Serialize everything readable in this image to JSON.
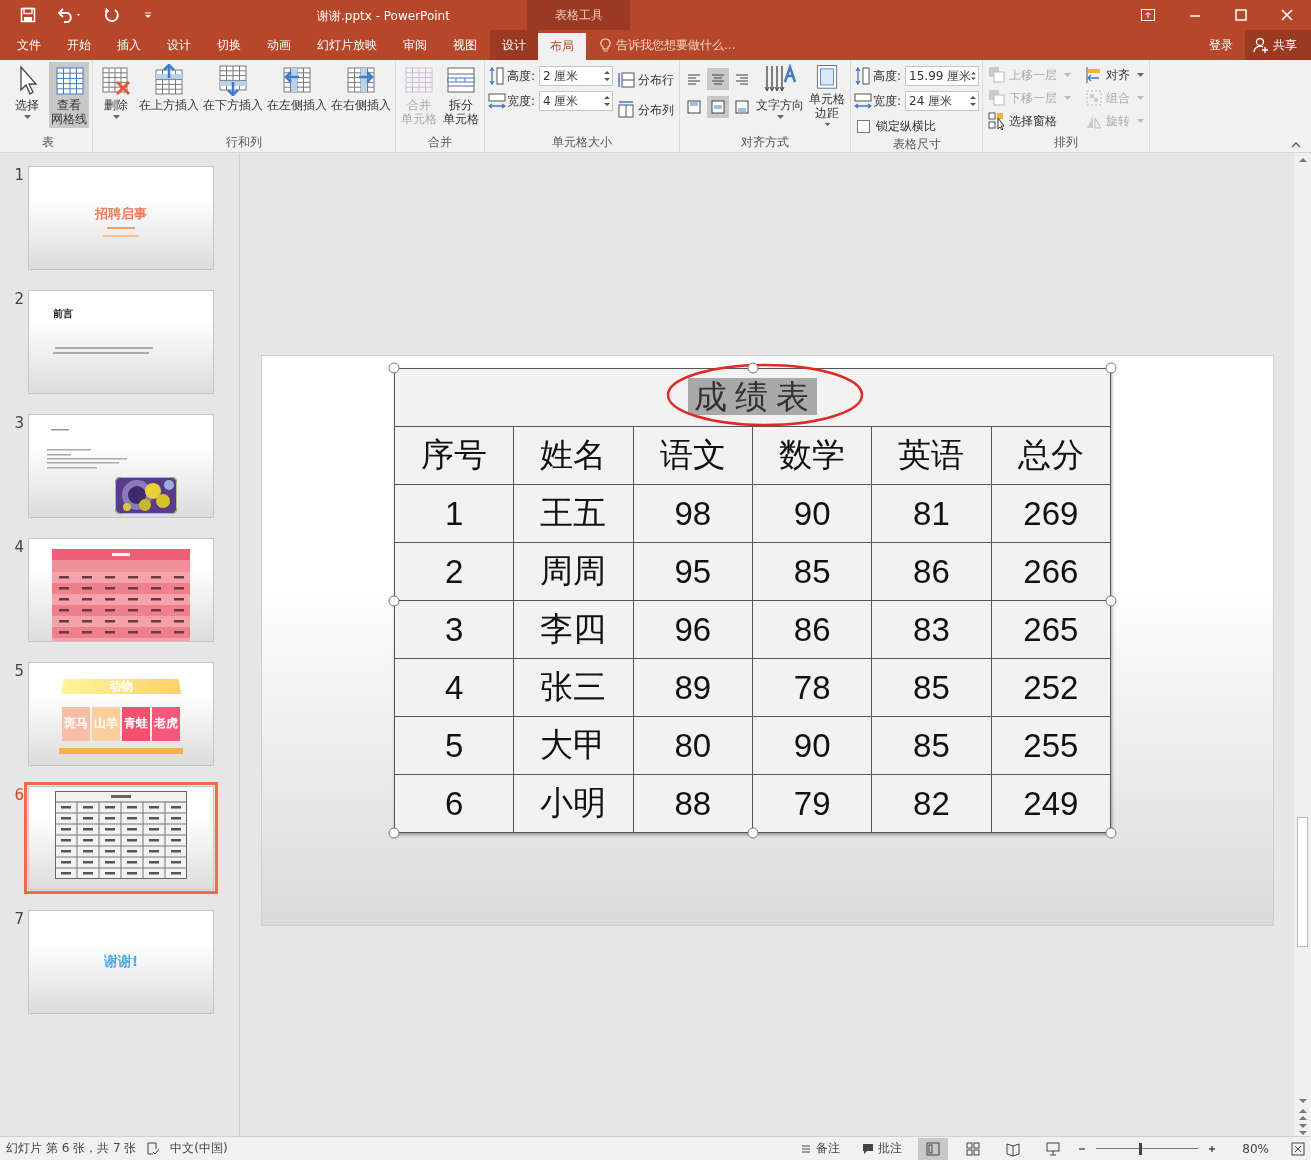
{
  "window": {
    "title": "谢谢.pptx - PowerPoint",
    "context_tab": "表格工具"
  },
  "menu_tabs": [
    {
      "label": "文件",
      "selected": false,
      "kind": "main"
    },
    {
      "label": "开始",
      "selected": false,
      "kind": "main"
    },
    {
      "label": "插入",
      "selected": false,
      "kind": "main"
    },
    {
      "label": "设计",
      "selected": false,
      "kind": "main"
    },
    {
      "label": "切换",
      "selected": false,
      "kind": "main"
    },
    {
      "label": "动画",
      "selected": false,
      "kind": "main"
    },
    {
      "label": "幻灯片放映",
      "selected": false,
      "kind": "main"
    },
    {
      "label": "审阅",
      "selected": false,
      "kind": "main"
    },
    {
      "label": "视图",
      "selected": false,
      "kind": "main"
    },
    {
      "label": "设计",
      "selected": false,
      "kind": "context"
    },
    {
      "label": "布局",
      "selected": true,
      "kind": "context"
    }
  ],
  "tell_me": {
    "placeholder": "告诉我您想要做什么..."
  },
  "account": {
    "sign_in": "登录",
    "share": "共享"
  },
  "ribbon": [
    {
      "label": "表",
      "kind": "large",
      "items": [
        {
          "lines": [
            "选择"
          ],
          "kind": "cursor",
          "dropdown": true,
          "on": false,
          "disabled": false
        },
        {
          "lines": [
            "查看",
            "网格线"
          ],
          "kind": "gridlines",
          "dropdown": false,
          "on": true,
          "disabled": false
        }
      ]
    },
    {
      "label": "行和列",
      "kind": "large",
      "items": [
        {
          "lines": [
            "删除"
          ],
          "kind": "delete",
          "dropdown": true,
          "on": false,
          "disabled": false
        },
        {
          "lines": [
            "在上方插入"
          ],
          "kind": "above",
          "dropdown": false,
          "on": false,
          "disabled": false
        },
        {
          "lines": [
            "在下方插入"
          ],
          "kind": "below",
          "dropdown": false,
          "on": false,
          "disabled": false
        },
        {
          "lines": [
            "在左侧插入"
          ],
          "kind": "left",
          "dropdown": false,
          "on": false,
          "disabled": false
        },
        {
          "lines": [
            "在右侧插入"
          ],
          "kind": "right",
          "dropdown": false,
          "on": false,
          "disabled": false
        }
      ]
    },
    {
      "label": "合并",
      "kind": "large",
      "items": [
        {
          "lines": [
            "合并",
            "单元格"
          ],
          "kind": "merge",
          "dropdown": false,
          "on": false,
          "disabled": true
        },
        {
          "lines": [
            "拆分",
            "单元格"
          ],
          "kind": "split",
          "dropdown": false,
          "on": false,
          "disabled": false
        }
      ]
    },
    {
      "label": "单元格大小",
      "kind": "cellsize",
      "fields": [
        {
          "label": "高度:",
          "value": "2 厘米",
          "kind": "height"
        },
        {
          "label": "宽度:",
          "value": "4 厘米",
          "kind": "width"
        }
      ],
      "buttons": [
        {
          "label": "分布行",
          "kind": "distrows"
        },
        {
          "label": "分布列",
          "kind": "distcols"
        }
      ]
    },
    {
      "label": "对齐方式",
      "kind": "align",
      "buttons": [
        {
          "kind": "left",
          "selected": false
        },
        {
          "kind": "center",
          "selected": true
        },
        {
          "kind": "right",
          "selected": false
        },
        {
          "kind": "top",
          "selected": false
        },
        {
          "kind": "middle",
          "selected": true
        },
        {
          "kind": "bottom",
          "selected": false
        }
      ],
      "items": [
        {
          "lines": [
            "文字方向"
          ],
          "kind": "textdir",
          "dropdown": true,
          "on": false,
          "disabled": false
        },
        {
          "lines": [
            "单元格",
            "边距"
          ],
          "kind": "margins",
          "dropdown": true,
          "on": false,
          "disabled": false
        }
      ]
    },
    {
      "label": "表格尺寸",
      "kind": "tablesize",
      "fields": [
        {
          "label": "高度:",
          "value": "15.99 厘米",
          "kind": "height"
        },
        {
          "label": "宽度:",
          "value": "24 厘米",
          "kind": "width"
        }
      ],
      "checkbox": {
        "label": "锁定纵横比",
        "checked": false
      }
    },
    {
      "label": "排列",
      "kind": "arrange",
      "items": [
        {
          "label": "上移一层",
          "kind": "forward",
          "dropdown": true,
          "disabled": true
        },
        {
          "label": "下移一层",
          "kind": "backward",
          "dropdown": true,
          "disabled": true
        },
        {
          "label": "选择窗格",
          "kind": "pane",
          "dropdown": false,
          "disabled": false
        },
        {
          "label": "对齐",
          "kind": "alignobj",
          "dropdown": true,
          "disabled": false
        },
        {
          "label": "组合",
          "kind": "group",
          "dropdown": true,
          "disabled": true
        },
        {
          "label": "旋转",
          "kind": "rotate",
          "dropdown": true,
          "disabled": true
        }
      ]
    }
  ],
  "slides": [
    {
      "number": "1",
      "selected": false,
      "kind": "title",
      "title": "招聘启事"
    },
    {
      "number": "2",
      "selected": false,
      "kind": "heading",
      "title": "前言"
    },
    {
      "number": "3",
      "selected": false
    },
    {
      "number": "4",
      "selected": false,
      "kind": "banded"
    },
    {
      "number": "5",
      "selected": false,
      "kind": "cards",
      "title": "动物",
      "cards": [
        {
          "label": "斑马",
          "color": "#f9bca4"
        },
        {
          "label": "山羊",
          "color": "#fbcf9c"
        },
        {
          "label": "青蛙",
          "color": "#f2506e"
        },
        {
          "label": "老虎",
          "color": "#f4587a"
        }
      ]
    },
    {
      "number": "6",
      "selected": true,
      "kind": "table"
    },
    {
      "number": "7",
      "selected": false,
      "kind": "closing",
      "title": "谢谢!"
    }
  ],
  "table": {
    "title": "成绩表",
    "columns": [
      "序号",
      "姓名",
      "语文",
      "数学",
      "英语",
      "总分"
    ],
    "rows": [
      [
        "1",
        "王五",
        "98",
        "90",
        "81",
        "269"
      ],
      [
        "2",
        "周周",
        "95",
        "85",
        "86",
        "266"
      ],
      [
        "3",
        "李四",
        "96",
        "86",
        "83",
        "265"
      ],
      [
        "4",
        "张三",
        "89",
        "78",
        "85",
        "252"
      ],
      [
        "5",
        "大甲",
        "80",
        "90",
        "85",
        "255"
      ],
      [
        "6",
        "小明",
        "88",
        "79",
        "82",
        "249"
      ]
    ]
  },
  "status_bar": {
    "slide_info": "幻灯片 第 6 张，共 7 张",
    "language": "中文(中国)",
    "notes": "备注",
    "comments": "批注",
    "views": [
      {
        "kind": "normal",
        "selected": true
      },
      {
        "kind": "sorter",
        "selected": false
      },
      {
        "kind": "reading",
        "selected": false
      },
      {
        "kind": "show",
        "selected": false
      }
    ],
    "zoom": {
      "level": 0.42,
      "reading": "80%"
    }
  }
}
